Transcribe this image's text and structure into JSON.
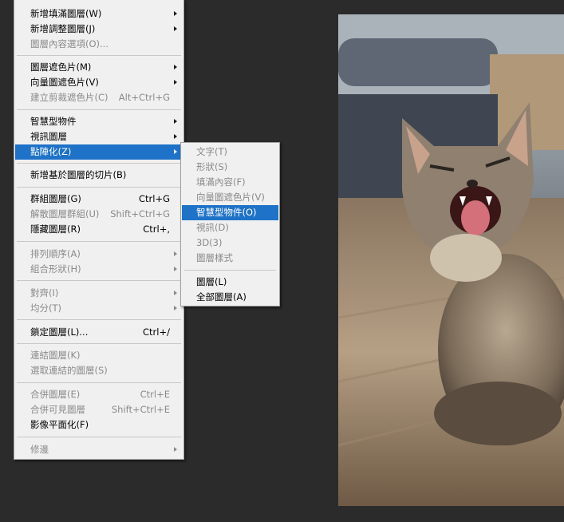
{
  "main_menu": [
    {
      "label": "新增填滿圖層(W)",
      "submenu": true
    },
    {
      "label": "新增調整圖層(J)",
      "submenu": true
    },
    {
      "label": "圖層內容選項(O)...",
      "disabled": true
    },
    {
      "label": "圖層遮色片(M)",
      "submenu": true
    },
    {
      "label": "向量圖遮色片(V)",
      "submenu": true
    },
    {
      "label": "建立剪裁遮色片(C)",
      "shortcut": "Alt+Ctrl+G",
      "disabled": true
    },
    {
      "label": "智慧型物件",
      "submenu": true
    },
    {
      "label": "視訊圖層",
      "submenu": true
    },
    {
      "label": "點陣化(Z)",
      "submenu": true,
      "highlight": true
    },
    {
      "label": "新增基於圖層的切片(B)"
    },
    {
      "label": "群組圖層(G)",
      "shortcut": "Ctrl+G"
    },
    {
      "label": "解散圖層群組(U)",
      "shortcut": "Shift+Ctrl+G",
      "disabled": true
    },
    {
      "label": "隱藏圖層(R)",
      "shortcut": "Ctrl+,"
    },
    {
      "label": "排列順序(A)",
      "submenu": true,
      "disabled": true
    },
    {
      "label": "組合形狀(H)",
      "submenu": true,
      "disabled": true
    },
    {
      "label": "對齊(I)",
      "submenu": true,
      "disabled": true
    },
    {
      "label": "均分(T)",
      "submenu": true,
      "disabled": true
    },
    {
      "label": "鎖定圖層(L)...",
      "shortcut": "Ctrl+/"
    },
    {
      "label": "連結圖層(K)",
      "disabled": true
    },
    {
      "label": "選取連結的圖層(S)",
      "disabled": true
    },
    {
      "label": "合併圖層(E)",
      "shortcut": "Ctrl+E",
      "disabled": true
    },
    {
      "label": "合併可見圖層",
      "shortcut": "Shift+Ctrl+E",
      "disabled": true
    },
    {
      "label": "影像平面化(F)"
    },
    {
      "label": "修邊",
      "submenu": true,
      "disabled": true
    }
  ],
  "rasterize_submenu": [
    {
      "label": "文字(T)",
      "disabled": true
    },
    {
      "label": "形狀(S)",
      "disabled": true
    },
    {
      "label": "填滿內容(F)",
      "disabled": true
    },
    {
      "label": "向量圖遮色片(V)",
      "disabled": true
    },
    {
      "label": "智慧型物件(O)",
      "highlight": true
    },
    {
      "label": "視訊(D)",
      "disabled": true
    },
    {
      "label": "3D(3)",
      "disabled": true
    },
    {
      "label": "圖層樣式",
      "disabled": true
    },
    {
      "label": "圖層(L)"
    },
    {
      "label": "全部圖層(A)"
    }
  ],
  "colors": {
    "highlight": "#1e72c8",
    "menu_bg": "#f0f0f0",
    "workspace_bg": "#2b2b2b"
  }
}
